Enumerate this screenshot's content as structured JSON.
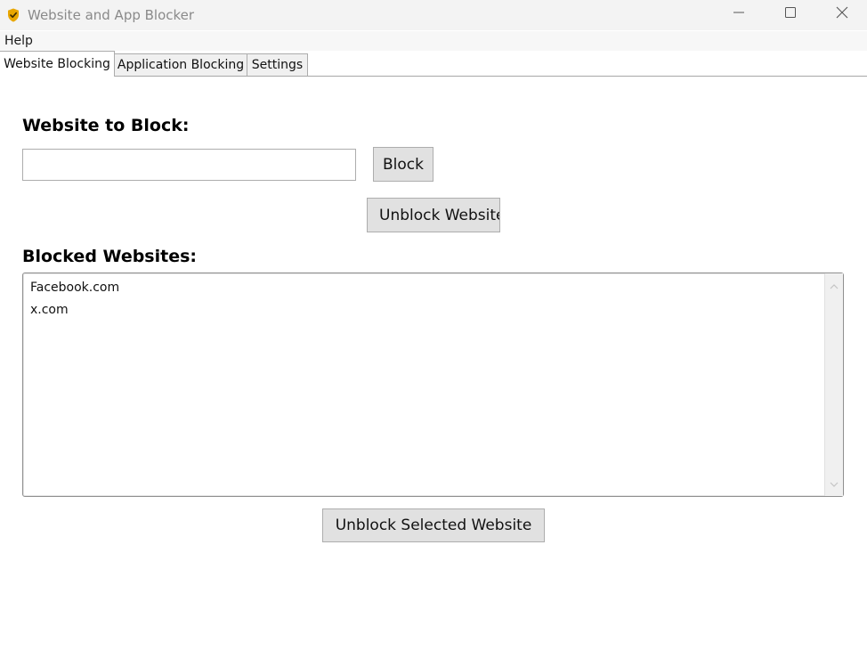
{
  "window": {
    "title": "Website and App Blocker",
    "icon": "shield-check-icon",
    "controls": [
      "minimize-icon",
      "maximize-icon",
      "close-icon"
    ]
  },
  "menu": {
    "items": [
      {
        "label": "Help"
      }
    ]
  },
  "tabs": [
    {
      "label": "Website Blocking",
      "selected": true
    },
    {
      "label": "Application Blocking",
      "selected": false
    },
    {
      "label": "Settings",
      "selected": false
    }
  ],
  "website_tab": {
    "input_label": "Website to Block:",
    "input_value": "",
    "block_button": "Block",
    "unblock_button": "Unblock Website",
    "list_label": "Blocked Websites:",
    "blocked_sites": [
      "Facebook.com",
      "x.com"
    ],
    "unblock_selected_button": "Unblock Selected Website"
  },
  "colors": {
    "titlebar_bg": "#f3f3f3",
    "button_bg": "#e1e1e1",
    "icon_gold": "#e8a600"
  }
}
